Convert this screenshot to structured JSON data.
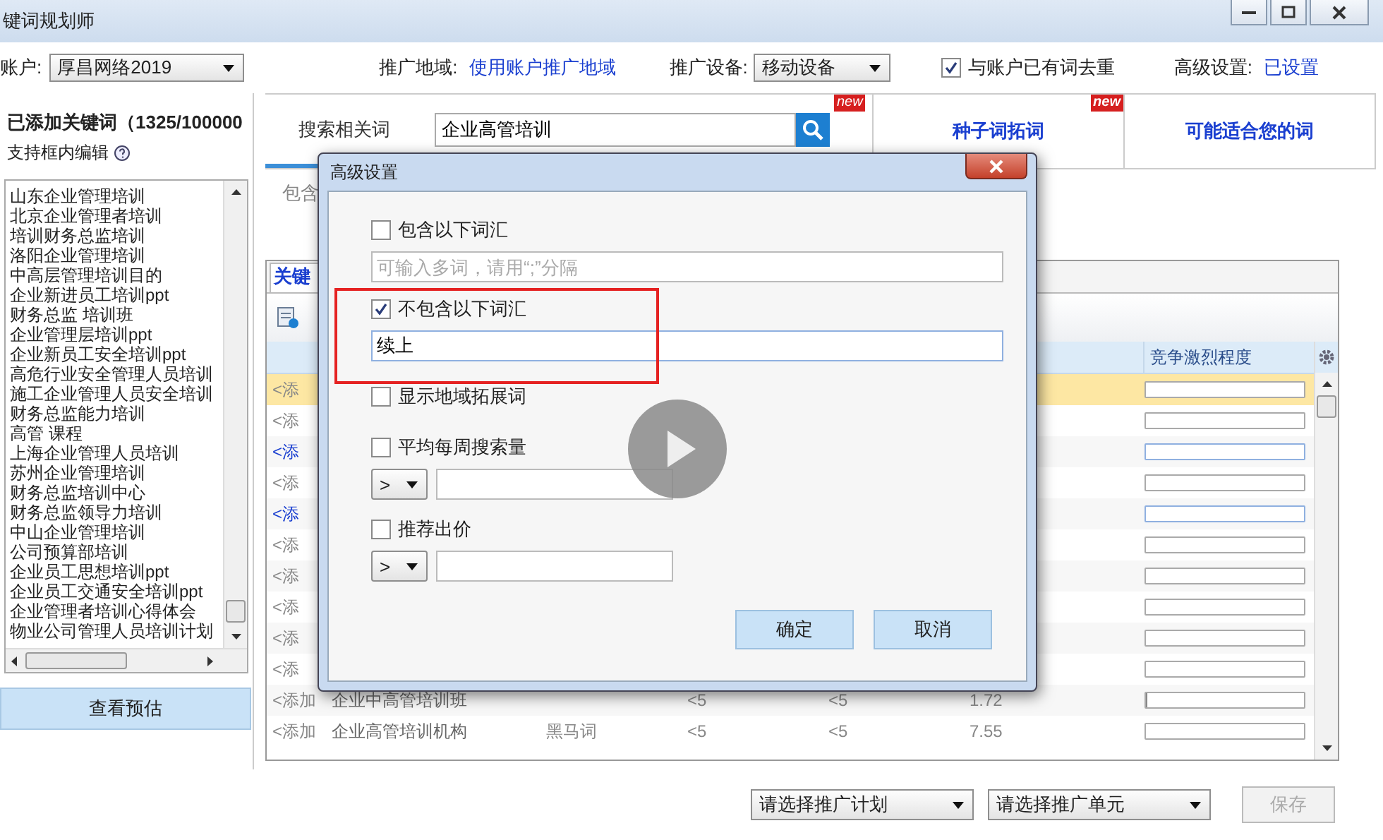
{
  "window": {
    "title": "键词规划师"
  },
  "toolbar": {
    "account_label": "账户:",
    "account": "厚昌网络2019",
    "region_label": "推广地域:",
    "region_link": "使用账户推广地域",
    "device_label": "推广设备:",
    "device": "移动设备",
    "dedupe": {
      "label": "与账户已有词去重",
      "checked": true
    },
    "advanced_label": "高级设置:",
    "advanced_link": "已设置"
  },
  "left_panel": {
    "title": "已添加关键词（1325/100000",
    "hint": "支持框内编辑",
    "keywords": [
      "山东企业管理培训",
      "北京企业管理者培训",
      "培训财务总监培训",
      "洛阳企业管理培训",
      "中高层管理培训目的",
      "企业新进员工培训ppt",
      "财务总监 培训班",
      "企业管理层培训ppt",
      "企业新员工安全培训ppt",
      "高危行业安全管理人员培训",
      "施工企业管理人员安全培训",
      "财务总监能力培训",
      "高管 课程",
      "上海企业管理人员培训",
      "苏州企业管理培训",
      "财务总监培训中心",
      "财务总监领导力培训",
      "中山企业管理培训",
      "公司预算部培训",
      "企业员工思想培训ppt",
      "企业员工交通安全培训ppt",
      "企业管理者培训心得体会",
      "物业公司管理人员培训计划"
    ],
    "estimate_button": "查看预估"
  },
  "tabs": [
    {
      "kind": "search",
      "label": "搜索相关词",
      "selected": true,
      "query": "企业高管培训",
      "badge": "new"
    },
    {
      "kind": "plain",
      "label": "种子词拓词",
      "selected": false,
      "badge": "new"
    },
    {
      "kind": "plain",
      "label": "可能适合您的词",
      "selected": false
    }
  ],
  "filters": {
    "include_label": "包含"
  },
  "results": {
    "tab": "关键",
    "header": "竞争激烈程度",
    "rows": [
      {
        "add": "<添",
        "selected": true,
        "active": false,
        "level": 0
      },
      {
        "add": "<添",
        "selected": false,
        "active": false,
        "level": 0
      },
      {
        "add": "<添",
        "selected": false,
        "active": true,
        "level": 0
      },
      {
        "add": "<添",
        "selected": false,
        "active": false,
        "level": 0
      },
      {
        "add": "<添",
        "selected": false,
        "active": true,
        "level": 0
      },
      {
        "add": "<添",
        "selected": false,
        "active": false,
        "level": 0
      },
      {
        "add": "<添",
        "selected": false,
        "active": false,
        "level": 0
      },
      {
        "add": "<添",
        "selected": false,
        "active": false,
        "level": 0
      },
      {
        "add": "<添",
        "selected": false,
        "active": false,
        "level": 0
      },
      {
        "add": "<添",
        "selected": false,
        "active": false,
        "level": 0
      },
      {
        "add": "<添加",
        "keyword": "企业中高管培训班",
        "col_4": "<5",
        "col_5": "<5",
        "col_6": "1.72",
        "selected": false,
        "active": false,
        "level": 0.01
      },
      {
        "add": "<添加",
        "keyword": "企业高管培训机构",
        "tag": "黑马词",
        "col_4": "<5",
        "col_5": "<5",
        "col_6": "7.55",
        "selected": false,
        "active": false,
        "level": 0
      }
    ]
  },
  "footer": {
    "plan": "请选择推广计划",
    "unit": "请选择推广单元",
    "save": {
      "label": "保存",
      "disabled": true
    }
  },
  "dialog": {
    "title": "高级设置",
    "options": [
      {
        "kind": "text",
        "label": "包含以下词汇",
        "checked": false,
        "placeholder": "可输入多词，请用“;”分隔",
        "highlighted": false
      },
      {
        "kind": "text",
        "label": "不包含以下词汇",
        "checked": true,
        "value": "续上",
        "highlighted": true
      },
      {
        "kind": "plain",
        "label": "显示地域拓展词",
        "checked": false
      },
      {
        "kind": "compare",
        "label": "平均每周搜索量",
        "checked": false,
        "operator": ">"
      },
      {
        "kind": "compare",
        "label": "推荐出价",
        "checked": false,
        "operator": ">"
      }
    ],
    "buttons": [
      "确定",
      "取消"
    ]
  }
}
